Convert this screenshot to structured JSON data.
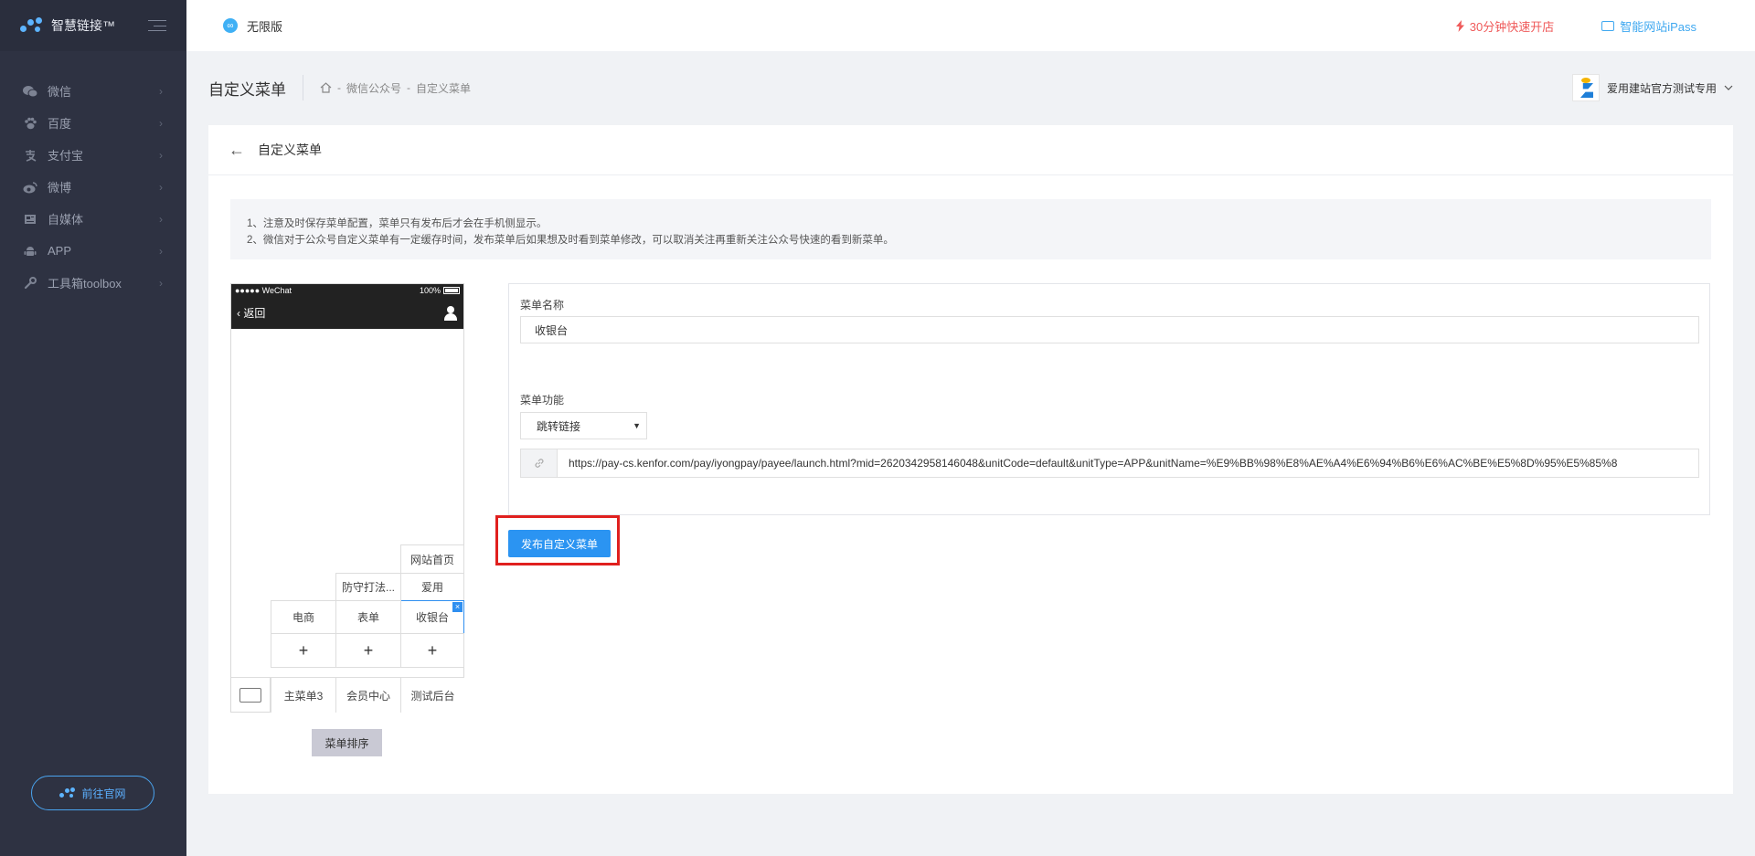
{
  "brand": {
    "name": "智慧链接™"
  },
  "sidebar": {
    "items": [
      {
        "label": "微信",
        "icon": "wechat-icon"
      },
      {
        "label": "百度",
        "icon": "paw-icon"
      },
      {
        "label": "支付宝",
        "icon": "alipay-icon"
      },
      {
        "label": "微博",
        "icon": "weibo-icon"
      },
      {
        "label": "自媒体",
        "icon": "media-icon"
      },
      {
        "label": "APP",
        "icon": "android-icon"
      },
      {
        "label": "工具箱toolbox",
        "icon": "wrench-icon"
      }
    ],
    "goto_label": "前往官网"
  },
  "topbar": {
    "version": "无限版",
    "quick_open": "30分钟快速开店",
    "ipass": "智能网站iPass"
  },
  "pagehead": {
    "title": "自定义菜单",
    "breadcrumb": [
      "微信公众号",
      "自定义菜单"
    ],
    "user": "爱用建站官方测试专用"
  },
  "card": {
    "title": "自定义菜单",
    "notice": [
      "1、注意及时保存菜单配置，菜单只有发布后才会在手机侧显示。",
      "2、微信对于公众号自定义菜单有一定缓存时间，发布菜单后如果想及时看到菜单修改，可以取消关注再重新关注公众号快速的看到新菜单。"
    ]
  },
  "phone": {
    "status_left": "●●●●● WeChat",
    "status_right": "100%",
    "back": "返回",
    "sub_menus": {
      "col3": [
        "网站首页",
        "爱用",
        "收银台"
      ],
      "col2": [
        "防守打法...",
        "表单"
      ],
      "col1": [
        "电商"
      ]
    },
    "main_menus": [
      "主菜单3",
      "会员中心",
      "测试后台"
    ],
    "plus": "+",
    "sort_label": "菜单排序"
  },
  "form": {
    "name_label": "菜单名称",
    "name_value": "收银台",
    "func_label": "菜单功能",
    "func_value": "跳转链接",
    "url_value": "https://pay-cs.kenfor.com/pay/iyongpay/payee/launch.html?mid=2620342958146048&unitCode=default&unitType=APP&unitName=%E9%BB%98%E8%AE%A4%E6%94%B6%E6%AC%BE%E5%8D%95%E5%85%8",
    "publish_label": "发布自定义菜单"
  },
  "colors": {
    "sidebar_bg": "#2e3242",
    "accent": "#2b94f2",
    "danger": "#ef5a5a",
    "highlight_border": "#e0201e"
  }
}
